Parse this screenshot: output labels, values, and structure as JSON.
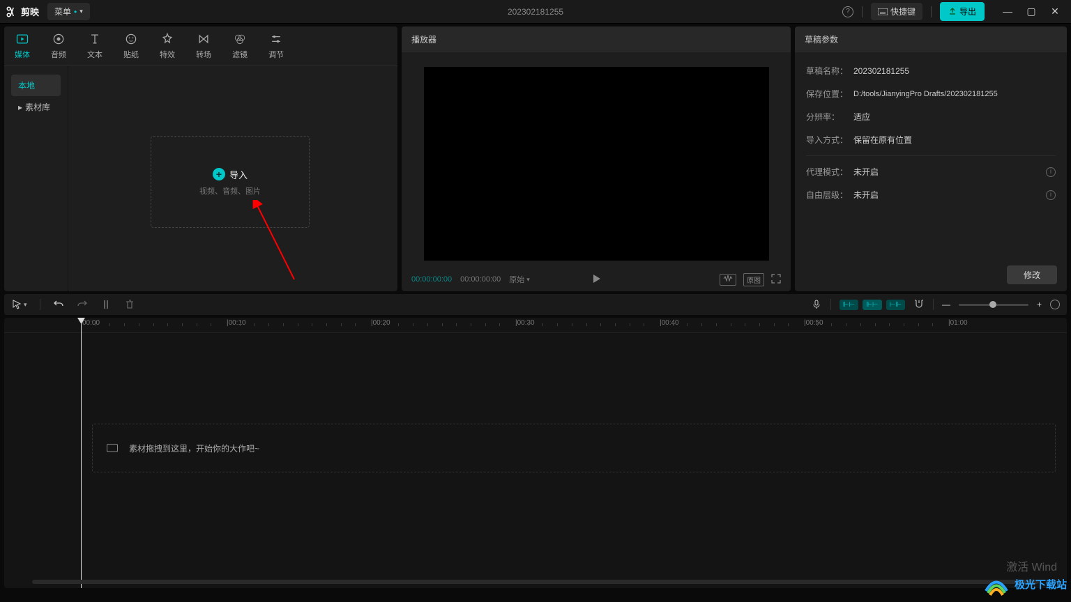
{
  "titlebar": {
    "app_name": "剪映",
    "menu_label": "菜单",
    "project_title": "202302181255",
    "shortcut_label": "快捷键",
    "export_label": "导出"
  },
  "media_tabs": [
    {
      "id": "media",
      "label": "媒体"
    },
    {
      "id": "audio",
      "label": "音频"
    },
    {
      "id": "text",
      "label": "文本"
    },
    {
      "id": "sticker",
      "label": "贴纸"
    },
    {
      "id": "effect",
      "label": "特效"
    },
    {
      "id": "transition",
      "label": "转场"
    },
    {
      "id": "filter",
      "label": "滤镜"
    },
    {
      "id": "adjust",
      "label": "调节"
    }
  ],
  "media_side": {
    "local": "本地",
    "library": "素材库"
  },
  "import_box": {
    "title": "导入",
    "subtitle": "视频、音频、图片"
  },
  "player": {
    "header": "播放器",
    "time_current": "00:00:00:00",
    "time_total": "00:00:00:00",
    "ratio_label": "原始"
  },
  "params": {
    "header": "草稿参数",
    "rows": {
      "name_label": "草稿名称：",
      "name_value": "202302181255",
      "path_label": "保存位置：",
      "path_value": "D:/tools/JianyingPro Drafts/202302181255",
      "res_label": "分辨率：",
      "res_value": "适应",
      "import_label": "导入方式：",
      "import_value": "保留在原有位置",
      "proxy_label": "代理模式：",
      "proxy_value": "未开启",
      "layer_label": "自由层级：",
      "layer_value": "未开启"
    },
    "modify": "修改"
  },
  "timeline": {
    "ticks": [
      "00:00",
      "|00:10",
      "|00:20",
      "|00:30",
      "|00:40",
      "|00:50",
      "|01:00"
    ],
    "drop_hint": "素材拖拽到这里，开始你的大作吧~"
  },
  "watermark": {
    "site": "极光下载站",
    "activate": "激活 Wind"
  }
}
